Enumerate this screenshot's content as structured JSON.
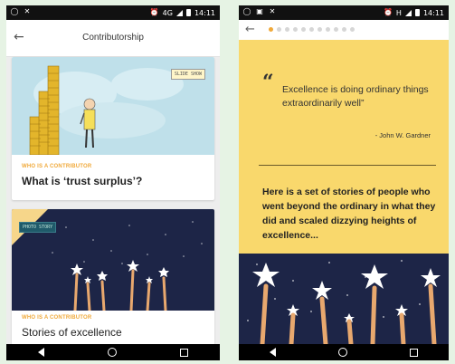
{
  "left_screen": {
    "status": {
      "network": "4G",
      "time": "14:11"
    },
    "app_bar": {
      "title": "Contributorship"
    },
    "cards": [
      {
        "badge": "SLIDE SHOW",
        "tag": "WHO IS A CONTRIBUTOR",
        "title": "What is ‘trust surplus’?"
      },
      {
        "badge": "PHOTO STORY",
        "tag": "WHO IS A CONTRIBUTOR",
        "title": "Stories of excellence"
      }
    ]
  },
  "right_screen": {
    "status": {
      "network": "H",
      "time": "14:11"
    },
    "pager": {
      "count": 11,
      "active": 0
    },
    "quote": {
      "text": "Excellence is doing ordinary things extraordinarily well”",
      "author": "- John W. Gardner"
    },
    "description": "Here is a set of stories of people who went beyond the ordinary in what they did and scaled dizzying heights of excellence..."
  },
  "colors": {
    "accent": "#f0a93a",
    "onboarding_bg": "#f9d86c",
    "night_sky": "#1d2547"
  }
}
